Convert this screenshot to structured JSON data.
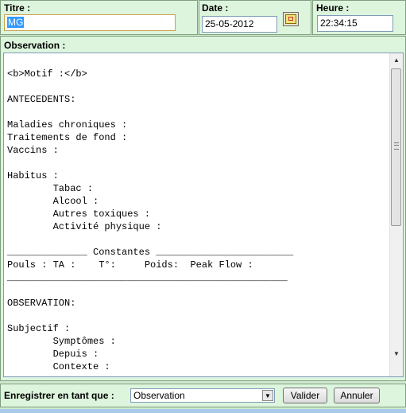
{
  "header": {
    "titre": {
      "label": "Titre :",
      "value": "MG"
    },
    "date": {
      "label": "Date :",
      "value": "25-05-2012"
    },
    "heure": {
      "label": "Heure :",
      "value": "22:34:15"
    }
  },
  "observation": {
    "label": "Observation :",
    "text": "<b>Motif :</b>\n\nANTECEDENTS:\n\nMaladies chroniques :\nTraitements de fond :\nVaccins :\n\nHabitus :\n        Tabac :\n        Alcool :\n        Autres toxiques :\n        Activité physique :\n\n______________ Constantes ________________________\nPouls : TA :    T°:     Poids:  Peak Flow :\n_________________________________________________\n\nOBSERVATION:\n\nSubjectif :\n        Symptômes :\n        Depuis :\n        Contexte :"
  },
  "footer": {
    "label": "Enregistrer en tant que :",
    "type_selected": "Observation",
    "valider": "Valider",
    "annuler": "Annuler"
  },
  "icons": {
    "calendar": "calendar-icon",
    "scroll_up": "arrow-up-icon",
    "scroll_down": "arrow-down-icon",
    "dropdown": "chevron-down-icon"
  }
}
